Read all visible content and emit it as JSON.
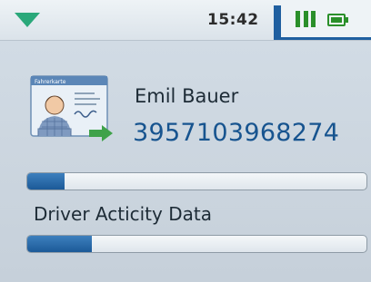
{
  "status_bar": {
    "time": "15:42",
    "menu_icon": "triangle-down-icon",
    "signal_icon": "signal-bars-icon",
    "battery_icon": "battery-icon"
  },
  "card": {
    "icon": "driver-card-icon",
    "card_title": "Fahrerkarte",
    "driver_name": "Emil Bauer",
    "card_number": "3957103968274"
  },
  "progress_top": {
    "fraction": 0.11
  },
  "activity": {
    "label": "Driver Acticity Data",
    "fraction": 0.19
  },
  "colors": {
    "accent_blue": "#1f5fa0",
    "status_green": "#2a8f2a",
    "arrow_green": "#2aa87a"
  }
}
